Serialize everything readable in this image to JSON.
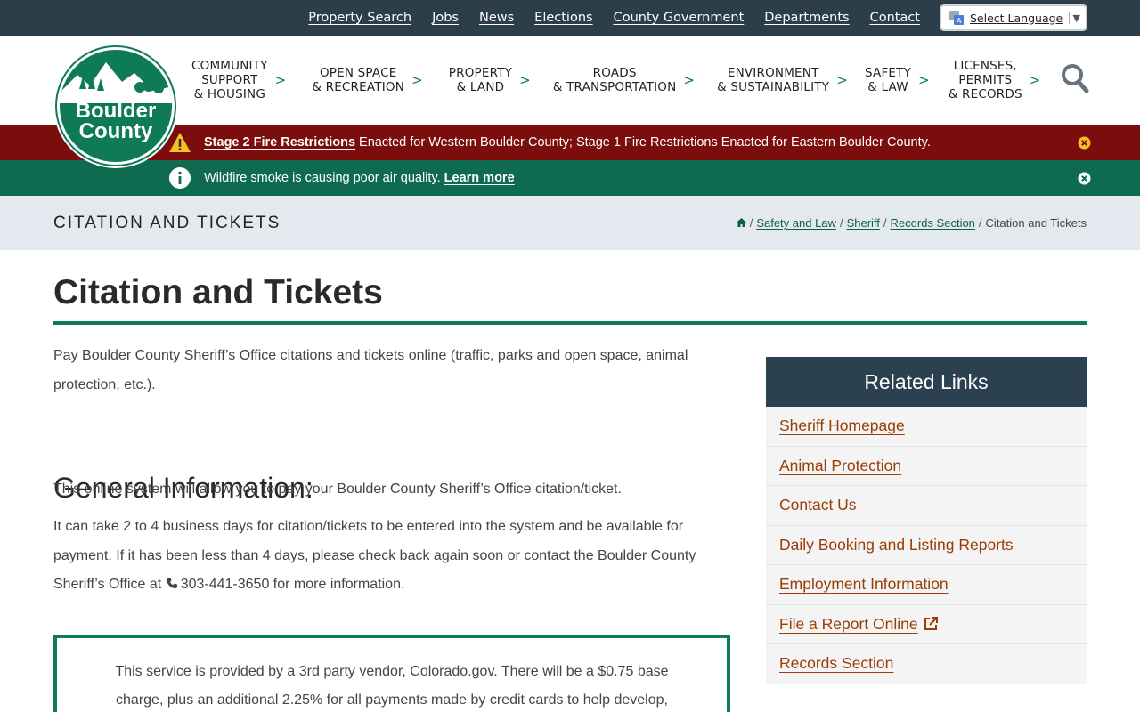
{
  "top_links": [
    "Property Search",
    "Jobs",
    "News",
    "Elections",
    "County Government",
    "Departments",
    "Contact"
  ],
  "language": {
    "label": "Select Language"
  },
  "logo": {
    "line1": "Boulder",
    "line2": "County"
  },
  "nav": [
    {
      "lines": [
        "COMMUNITY",
        "SUPPORT",
        "& HOUSING"
      ]
    },
    {
      "lines": [
        "OPEN SPACE",
        "& RECREATION"
      ]
    },
    {
      "lines": [
        "PROPERTY",
        "& LAND"
      ]
    },
    {
      "lines": [
        "ROADS",
        "& TRANSPORTATION"
      ]
    },
    {
      "lines": [
        "ENVIRONMENT",
        "& SUSTAINABILITY"
      ]
    },
    {
      "lines": [
        "SAFETY",
        "& LAW"
      ]
    },
    {
      "lines": [
        "LICENSES,",
        "PERMITS",
        "& RECORDS"
      ]
    }
  ],
  "alerts": {
    "fire": {
      "link": "Stage 2 Fire Restrictions",
      "text": "Enacted for Western Boulder County; Stage 1 Fire Restrictions Enacted for Eastern Boulder County."
    },
    "smoke": {
      "text": "Wildfire smoke is causing poor air quality.",
      "link": "Learn more"
    }
  },
  "page_title_bar": "CITATION AND TICKETS",
  "breadcrumbs": [
    "Safety and Law",
    "Sheriff",
    "Records Section"
  ],
  "breadcrumb_current": "Citation and Tickets",
  "heading": "Citation and Tickets",
  "intro": "Pay Boulder County Sheriff’s Office citations and tickets online (traffic, parks and open space, animal protection, etc.).",
  "general_heading": "General Information:",
  "para1": "This online system will allow you to pay your Boulder County Sheriff’s Office citation/ticket.",
  "para2_before": "It can take 2 to 4 business days for citation/tickets to be entered into the system and be available for payment. If it has been less than 4 days, please check back again soon or contact the Boulder County Sheriff’s Office at",
  "phone": "303-441-3650",
  "para2_after": "for more information.",
  "notice": "This service is provided by a 3rd party vendor, Colorado.gov. There will be a $0.75 base charge, plus an additional 2.25% for all payments made by credit cards to help develop,",
  "sidebar": {
    "title": "Related Links",
    "links": [
      "Sheriff Homepage",
      "Animal Protection",
      "Contact Us",
      "Daily Booking and Listing Reports",
      "Employment Information",
      "File a Report Online",
      "Records Section"
    ]
  },
  "colors": {
    "dark_bar": "#2c3e4a",
    "brand_green": "#0f7a58",
    "alert_red": "#7b0d0d",
    "link_orange": "#9a3d06"
  }
}
